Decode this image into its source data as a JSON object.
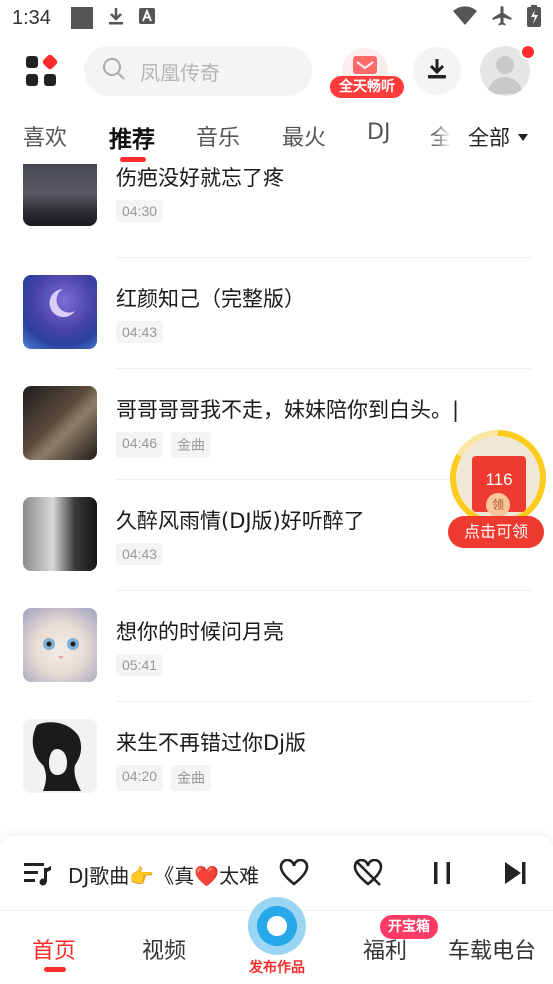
{
  "status_bar": {
    "time": "1:34"
  },
  "header": {
    "search_placeholder": "凤凰传奇",
    "vip_label": "全天畅听",
    "icons": [
      "app-grid-icon",
      "search-icon",
      "download-icon",
      "avatar-icon"
    ],
    "accent_color": "#ff2c2c"
  },
  "tabs": {
    "items": [
      "喜欢",
      "推荐",
      "音乐",
      "最火",
      "DJ",
      "全"
    ],
    "active": "推荐",
    "all_label": "全部"
  },
  "songs": [
    {
      "title": "伤疤没好就忘了疼",
      "duration": "04:30",
      "tag": ""
    },
    {
      "title": "红颜知己（完整版）",
      "duration": "04:43",
      "tag": ""
    },
    {
      "title": "哥哥哥哥我不走，妹妹陪你到白头。|",
      "duration": "04:46",
      "tag": "金曲"
    },
    {
      "title": "久醉风雨情(DJ版)好听醉了",
      "duration": "04:43",
      "tag": ""
    },
    {
      "title": "想你的时候问月亮",
      "duration": "05:41",
      "tag": ""
    },
    {
      "title": "来生不再错过你Dj版",
      "duration": "04:20",
      "tag": "金曲"
    }
  ],
  "reward": {
    "count": "116",
    "coin": "领",
    "label": "点击可领"
  },
  "player": {
    "marquee": "DJ歌曲👉《真❤️太难"
  },
  "bottom_nav": {
    "items": [
      "首页",
      "视频",
      "福利",
      "车载电台"
    ],
    "active": "首页",
    "publish_label": "发布作品",
    "badge": "开宝箱"
  }
}
